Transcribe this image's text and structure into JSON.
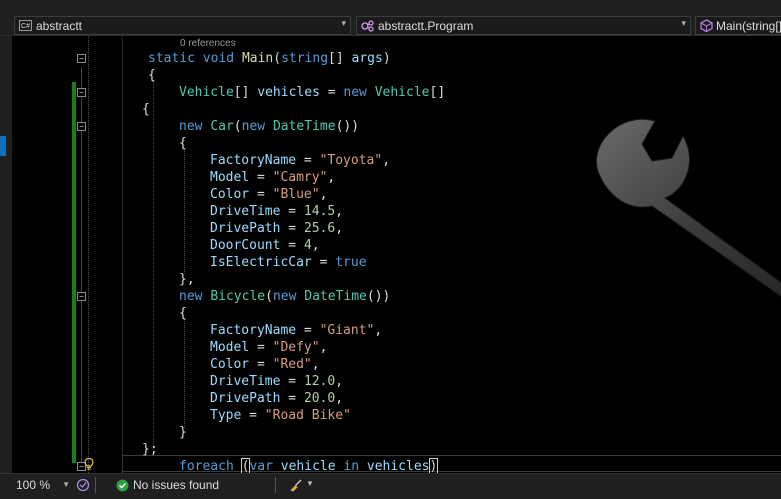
{
  "nav": {
    "project": "abstractt",
    "project_badge": "C#",
    "type_scope": "abstractt.Program",
    "member": "Main(string[]"
  },
  "editor": {
    "codelens": "0 references",
    "lines": [
      [
        [
          "kw",
          "static "
        ],
        [
          "kw",
          "void "
        ],
        [
          "fn",
          "Main"
        ],
        [
          "pu",
          "("
        ],
        [
          "kw",
          "string"
        ],
        [
          "pu",
          "[] "
        ],
        [
          "id",
          "args"
        ],
        [
          "pu",
          ")"
        ]
      ],
      [
        [
          "pu",
          "{"
        ]
      ],
      [
        [
          "ty",
          "Vehicle"
        ],
        [
          "pu",
          "[] "
        ],
        [
          "id",
          "vehicles"
        ],
        [
          "pu",
          " = "
        ],
        [
          "kw",
          "new "
        ],
        [
          "ty",
          "Vehicle"
        ],
        [
          "pu",
          "[]"
        ]
      ],
      [
        [
          "pu",
          "{"
        ]
      ],
      [
        [
          "kw",
          "new "
        ],
        [
          "ty",
          "Car"
        ],
        [
          "pu",
          "("
        ],
        [
          "kw",
          "new "
        ],
        [
          "ty",
          "DateTime"
        ],
        [
          "pu",
          "())"
        ]
      ],
      [
        [
          "pu",
          "{"
        ]
      ],
      [
        [
          "id",
          "FactoryName"
        ],
        [
          "pu",
          " = "
        ],
        [
          "st",
          "\"Toyota\""
        ],
        [
          "pu",
          ","
        ]
      ],
      [
        [
          "id",
          "Model"
        ],
        [
          "pu",
          " = "
        ],
        [
          "st",
          "\"Camry\""
        ],
        [
          "pu",
          ","
        ]
      ],
      [
        [
          "id",
          "Color"
        ],
        [
          "pu",
          " = "
        ],
        [
          "st",
          "\"Blue\""
        ],
        [
          "pu",
          ","
        ]
      ],
      [
        [
          "id",
          "DriveTime"
        ],
        [
          "pu",
          " = "
        ],
        [
          "nu",
          "14.5"
        ],
        [
          "pu",
          ","
        ]
      ],
      [
        [
          "id",
          "DrivePath"
        ],
        [
          "pu",
          " = "
        ],
        [
          "nu",
          "25.6"
        ],
        [
          "pu",
          ","
        ]
      ],
      [
        [
          "id",
          "DoorCount"
        ],
        [
          "pu",
          " = "
        ],
        [
          "nu",
          "4"
        ],
        [
          "pu",
          ","
        ]
      ],
      [
        [
          "id",
          "IsElectricCar"
        ],
        [
          "pu",
          " = "
        ],
        [
          "kw",
          "true"
        ]
      ],
      [
        [
          "pu",
          "},"
        ]
      ],
      [
        [
          "kw",
          "new "
        ],
        [
          "ty",
          "Bicycle"
        ],
        [
          "pu",
          "("
        ],
        [
          "kw",
          "new "
        ],
        [
          "ty",
          "DateTime"
        ],
        [
          "pu",
          "())"
        ]
      ],
      [
        [
          "pu",
          "{"
        ]
      ],
      [
        [
          "id",
          "FactoryName"
        ],
        [
          "pu",
          " = "
        ],
        [
          "st",
          "\"Giant\""
        ],
        [
          "pu",
          ","
        ]
      ],
      [
        [
          "id",
          "Model"
        ],
        [
          "pu",
          " = "
        ],
        [
          "st",
          "\"Defy\""
        ],
        [
          "pu",
          ","
        ]
      ],
      [
        [
          "id",
          "Color"
        ],
        [
          "pu",
          " = "
        ],
        [
          "st",
          "\"Red\""
        ],
        [
          "pu",
          ","
        ]
      ],
      [
        [
          "id",
          "DriveTime"
        ],
        [
          "pu",
          " = "
        ],
        [
          "nu",
          "12.0"
        ],
        [
          "pu",
          ","
        ]
      ],
      [
        [
          "id",
          "DrivePath"
        ],
        [
          "pu",
          " = "
        ],
        [
          "nu",
          "20.0"
        ],
        [
          "pu",
          ","
        ]
      ],
      [
        [
          "id",
          "Type"
        ],
        [
          "pu",
          " = "
        ],
        [
          "st",
          "\"Road Bike\""
        ]
      ],
      [
        [
          "pu",
          "}"
        ]
      ],
      [
        [
          "pu",
          "};"
        ]
      ],
      [
        [
          "kw",
          "foreach "
        ],
        [
          "pu",
          "("
        ],
        [
          "kw",
          "var "
        ],
        [
          "id",
          "vehicle "
        ],
        [
          "kw",
          "in "
        ],
        [
          "id",
          "vehicles"
        ],
        [
          "pu",
          ")"
        ]
      ]
    ]
  },
  "status": {
    "zoom": "100 %",
    "issues": "No issues found"
  },
  "colors": {
    "keyword": "#569cd6",
    "type": "#4ec9b0",
    "identifier": "#9cdcfe",
    "method": "#dcdcaa",
    "string": "#d69d85",
    "number": "#b5cea8",
    "change_bar": "#1a7f1a",
    "ok": "#2ea043"
  }
}
